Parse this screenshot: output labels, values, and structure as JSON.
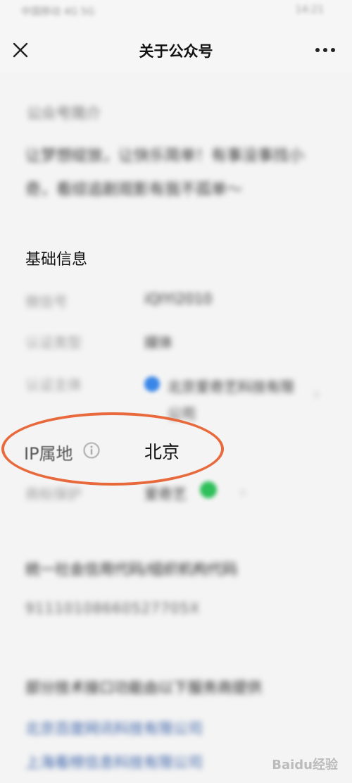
{
  "statusbar": {
    "left": "中国移动 4G 5G",
    "right": "14:21"
  },
  "navbar": {
    "title": "关于公众号",
    "close_icon": "close-icon",
    "more_icon": "more-dots-icon"
  },
  "intro": {
    "title": "公众号简介",
    "body": "让梦想绽放，让快乐简单！有事没事找小奇，看综追剧观影有我不孤单～"
  },
  "basic": {
    "title": "基础信息",
    "rows": [
      {
        "label": "微信号",
        "value": "iQIYI2010"
      },
      {
        "label": "认证类型",
        "value": "媒体"
      },
      {
        "label": "认证主体",
        "value": "北京爱奇艺科技有限公司"
      },
      {
        "label": "IP属地",
        "value": "北京"
      },
      {
        "label": "商标保护",
        "value": "爱奇艺"
      }
    ]
  },
  "credit": {
    "title": "统一社会信用代码/组织机构代码",
    "value": "91110108660527705X"
  },
  "tech": {
    "title": "部分技术接口功能由以下服务商提供",
    "providers": [
      "北京百度网讯科技有限公司",
      "上海看榜信息科技有限公司"
    ]
  },
  "watermark": "Baidu经验",
  "colors": {
    "highlight_oval": "#e86a3c",
    "link": "#3b62a8",
    "verified_dot": "#3a86e8",
    "trademark_dot": "#2fbf5a"
  }
}
